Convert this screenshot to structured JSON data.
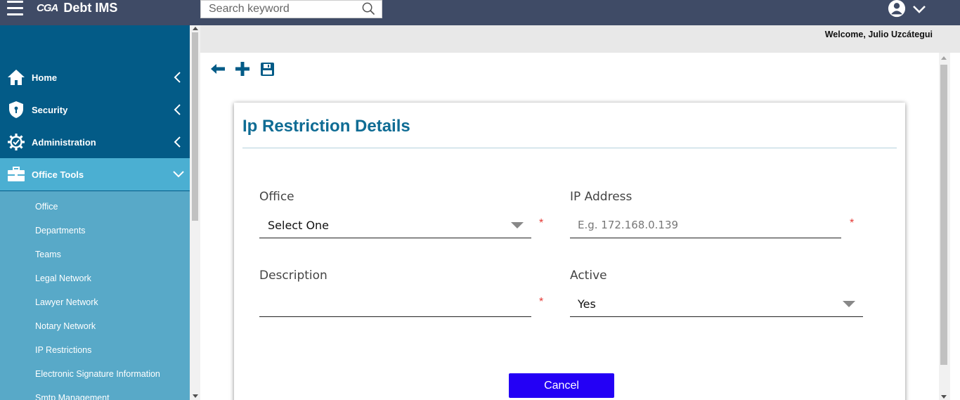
{
  "app": {
    "logo_mark": "CGA",
    "title": "Debt IMS"
  },
  "search": {
    "placeholder": "Search keyword"
  },
  "header": {
    "welcome": "Welcome, Julio Uzcátegui"
  },
  "sidebar": {
    "items": [
      {
        "label": "Home",
        "icon": "home-icon"
      },
      {
        "label": "Security",
        "icon": "shield-icon"
      },
      {
        "label": "Administration",
        "icon": "gear-icon"
      },
      {
        "label": "Office Tools",
        "icon": "briefcase-icon",
        "active": true
      }
    ],
    "subitems": [
      "Office",
      "Departments",
      "Teams",
      "Legal Network",
      "Lawyer Network",
      "Notary Network",
      "IP Restrictions",
      "Electronic Signature Information",
      "Smtp Management"
    ]
  },
  "toolbar": {
    "icons": [
      "back-arrow-icon",
      "add-plus-icon",
      "save-disk-icon"
    ]
  },
  "form": {
    "title": "Ip Restriction Details",
    "office": {
      "label": "Office",
      "value": "Select One",
      "required": "*"
    },
    "ip_address": {
      "label": "IP Address",
      "placeholder": "E.g. 172.168.0.139",
      "required": "*"
    },
    "description": {
      "label": "Description",
      "value": "",
      "required": "*"
    },
    "active": {
      "label": "Active",
      "value": "Yes"
    },
    "cancel_label": "Cancel"
  },
  "colors": {
    "topbar": "#3f4b66",
    "sidebar": "#035b87",
    "sidebar_active": "#4bafd2",
    "subnav": "#58a9c8",
    "title": "#0f6c94",
    "cancel_button": "#2400f5",
    "required": "#e53935"
  }
}
